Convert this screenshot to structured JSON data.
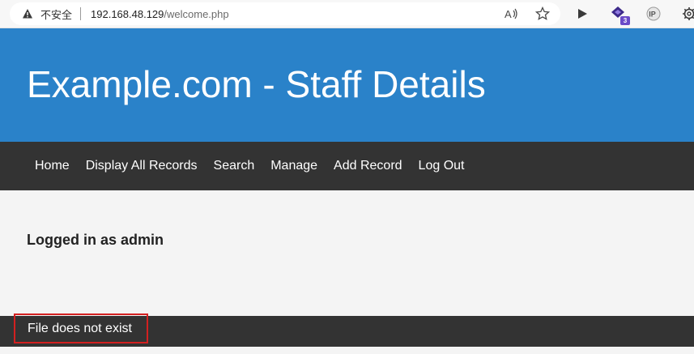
{
  "browser": {
    "security_label": "不安全",
    "url_host": "192.168.48.129",
    "url_path": "/welcome.php",
    "extension_badge": "3",
    "icons": [
      "warning-icon",
      "read-aloud-icon",
      "favorite-star-icon",
      "play-icon",
      "extension-icon",
      "ip-icon",
      "settings-icon"
    ]
  },
  "site": {
    "title": "Example.com - Staff Details"
  },
  "nav": {
    "items": [
      {
        "label": "Home"
      },
      {
        "label": "Display All Records"
      },
      {
        "label": "Search"
      },
      {
        "label": "Manage"
      },
      {
        "label": "Add Record"
      },
      {
        "label": "Log Out"
      }
    ]
  },
  "main": {
    "logged_in_text": "Logged in as admin"
  },
  "footer": {
    "message": "File does not exist"
  },
  "colors": {
    "header_bg": "#2a82c9",
    "nav_bg": "#333333",
    "highlight": "#d32020"
  }
}
